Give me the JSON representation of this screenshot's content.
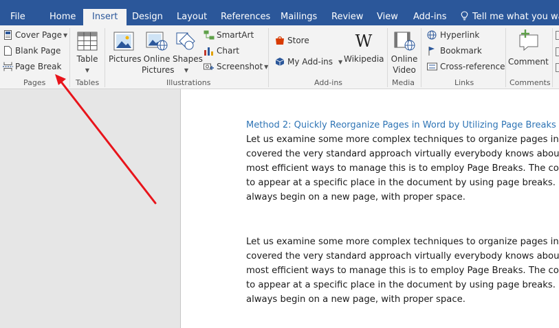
{
  "tabs": {
    "file": "File",
    "home": "Home",
    "insert": "Insert",
    "design": "Design",
    "layout": "Layout",
    "references": "References",
    "mailings": "Mailings",
    "review": "Review",
    "view": "View",
    "addins": "Add-ins",
    "tell_me": "Tell me what you want"
  },
  "ribbon": {
    "pages": {
      "group_label": "Pages",
      "cover_page": "Cover Page",
      "blank_page": "Blank Page",
      "page_break": "Page Break"
    },
    "tables": {
      "group_label": "Tables",
      "table": "Table"
    },
    "illustrations": {
      "group_label": "Illustrations",
      "pictures": "Pictures",
      "online_pictures_1": "Online",
      "online_pictures_2": "Pictures",
      "shapes": "Shapes",
      "smartart": "SmartArt",
      "chart": "Chart",
      "screenshot": "Screenshot"
    },
    "addins": {
      "group_label": "Add-ins",
      "store": "Store",
      "my_addins": "My Add-ins",
      "wikipedia": "Wikipedia"
    },
    "media": {
      "group_label": "Media",
      "online_video_1": "Online",
      "online_video_2": "Video"
    },
    "links": {
      "group_label": "Links",
      "hyperlink": "Hyperlink",
      "bookmark": "Bookmark",
      "cross_reference": "Cross-reference"
    },
    "comments": {
      "group_label": "Comments",
      "comment": "Comment"
    }
  },
  "document": {
    "heading": "Method 2: Quickly Reorganize Pages in Word by Utilizing Page Breaks",
    "paragraph1": [
      "Let us examine some more complex techniques to organize pages in",
      "covered the very standard approach virtually everybody knows abou",
      "most efficient ways to manage this is to employ Page Breaks. The con",
      "to appear at a specific place in the document by using page breaks.",
      "always begin on a new page, with proper space."
    ],
    "paragraph2": [
      "Let us examine some more complex techniques to organize pages in",
      "covered the very standard approach virtually everybody knows abou",
      "most efficient ways to manage this is to employ Page Breaks. The con",
      "to appear at a specific place in the document by using page breaks.",
      "always begin on a new page, with proper space."
    ]
  },
  "colors": {
    "title_bar": "#2b579a",
    "ribbon_bg": "#f3f3f3",
    "heading": "#2e74b5",
    "annotation_arrow": "#e8141b"
  }
}
